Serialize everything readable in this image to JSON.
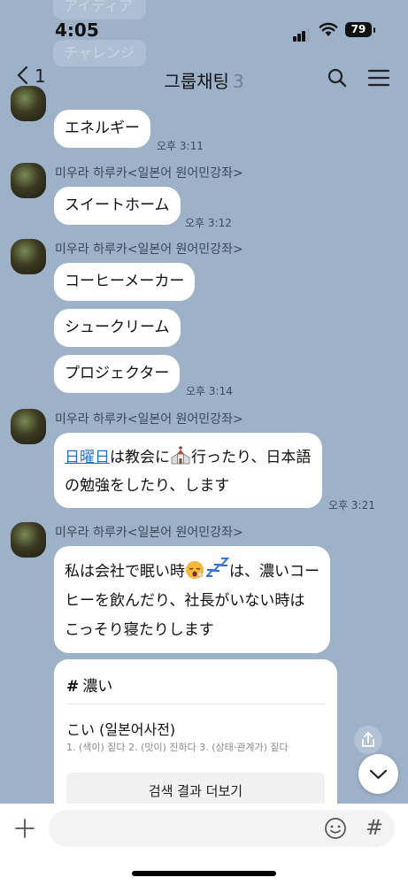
{
  "status": {
    "time": "4:05",
    "battery": "79"
  },
  "background_hints": [
    "アイディア",
    "チャレンジ"
  ],
  "header": {
    "back_count": "1",
    "title": "그룹채팅",
    "member_count": "3"
  },
  "sender_name": "미우라 하루카<일본어 원어민강좌>",
  "messages": {
    "m1": {
      "text": "エネルギー",
      "time": "오후 3:11"
    },
    "m2": {
      "text": "スイートホーム",
      "time": "오후 3:12"
    },
    "m3": {
      "texts": [
        "コーヒーメーカー",
        "シュークリーム",
        "プロジェクター"
      ],
      "time": "오후 3:14"
    },
    "m4": {
      "link": "日曜日",
      "line1_a": "は教会に",
      "line1_b": "行ったり、日本語",
      "line2": "の勉強をしたり、します",
      "time": "오후 3:21"
    },
    "m5": {
      "line1_a": "私は会社で眠い時",
      "line1_b": "は、濃いコー",
      "line2": "ヒーを飲んだり、社長がいない時は",
      "line3": "こっそり寝たりします"
    }
  },
  "dict_card": {
    "hash": "#",
    "title": "濃い",
    "word": "こい (일본어사전)",
    "definition": "1. (색이) 짙다 2. (맛이) 진하다 3. (상태·관계가) 짙다",
    "button": "검색 결과 더보기"
  },
  "input": {
    "hash_button": "#"
  },
  "colors": {
    "chat_bg": "#9db1c9",
    "link": "#1f6fd6",
    "bubble": "#ffffff"
  },
  "icons": [
    "chevron-left-icon",
    "search-icon",
    "menu-icon",
    "church-icon",
    "sleepy-face-emoji",
    "zzz-emoji",
    "share-icon",
    "chevron-down-icon",
    "plus-icon",
    "smiley-icon"
  ]
}
